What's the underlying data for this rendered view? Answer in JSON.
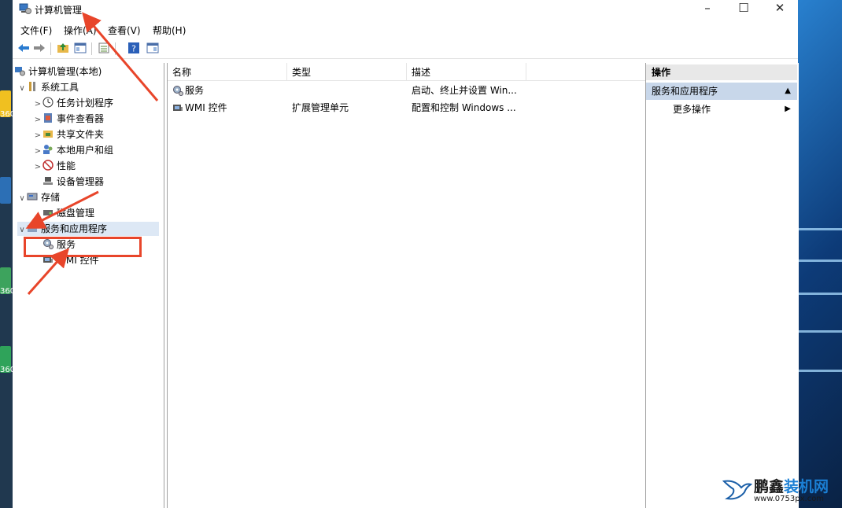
{
  "window": {
    "title": "计算机管理",
    "controls": [
      "–",
      "☐",
      "✕"
    ]
  },
  "menu": [
    "文件(F)",
    "操作(A)",
    "查看(V)",
    "帮助(H)"
  ],
  "toolbar_icons": [
    "back-arrow-icon",
    "forward-arrow-icon",
    "up-folder-icon",
    "show-tree-icon",
    "export-list-icon",
    "help-icon",
    "properties-icon"
  ],
  "tree": {
    "root": "计算机管理(本地)",
    "items": [
      {
        "label": "系统工具",
        "arrow": "∨",
        "level": 1
      },
      {
        "label": "任务计划程序",
        "arrow": ">",
        "level": 2
      },
      {
        "label": "事件查看器",
        "arrow": ">",
        "level": 2
      },
      {
        "label": "共享文件夹",
        "arrow": ">",
        "level": 2
      },
      {
        "label": "本地用户和组",
        "arrow": ">",
        "level": 2
      },
      {
        "label": "性能",
        "arrow": ">",
        "level": 2
      },
      {
        "label": "设备管理器",
        "arrow": "",
        "level": 2
      },
      {
        "label": "存储",
        "arrow": "∨",
        "level": 1
      },
      {
        "label": "磁盘管理",
        "arrow": "",
        "level": 2
      },
      {
        "label": "服务和应用程序",
        "arrow": "∨",
        "level": 1
      },
      {
        "label": "服务",
        "arrow": "",
        "level": 2
      },
      {
        "label": "WMI 控件",
        "arrow": "",
        "level": 2
      }
    ]
  },
  "list": {
    "columns": [
      "名称",
      "类型",
      "描述"
    ],
    "rows": [
      {
        "name": "服务",
        "type": "",
        "desc": "启动、终止并设置 Win..."
      },
      {
        "name": "WMI 控件",
        "type": "扩展管理单元",
        "desc": "配置和控制 Windows ..."
      }
    ]
  },
  "actions": {
    "header": "操作",
    "section": "服务和应用程序",
    "section_glyph": "▲",
    "item": "更多操作",
    "item_glyph": "▶"
  },
  "desktop_labels": [
    "360",
    "360",
    "360",
    "360"
  ],
  "watermark": {
    "name_a": "鹏鑫",
    "name_b": "装机网",
    "url": "www.0753px.com"
  },
  "colors": {
    "annotation": "#e8452a",
    "selection": "#c8d7ea"
  }
}
